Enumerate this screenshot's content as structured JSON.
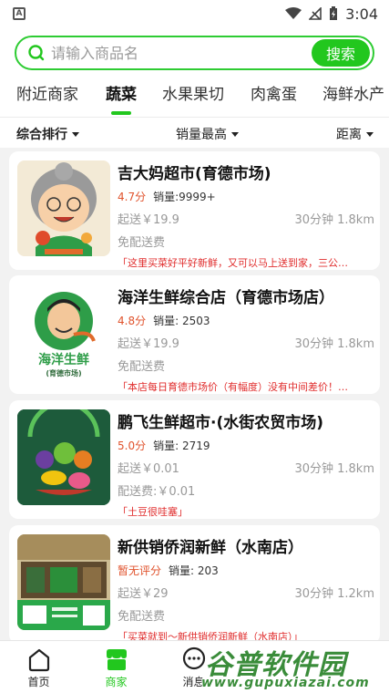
{
  "status_bar": {
    "time": "3:04",
    "left_badge": "A"
  },
  "search": {
    "placeholder": "请输入商品名",
    "button_label": "搜索"
  },
  "tabs": [
    {
      "label": "附近商家",
      "active": false
    },
    {
      "label": "蔬菜",
      "active": true
    },
    {
      "label": "水果果切",
      "active": false
    },
    {
      "label": "肉禽蛋",
      "active": false
    },
    {
      "label": "海鲜水产",
      "active": false
    }
  ],
  "filters": [
    {
      "label": "综合排行"
    },
    {
      "label": "销量最高"
    },
    {
      "label": "距离"
    }
  ],
  "stores": [
    {
      "name": "吉大妈超市(育德市场)",
      "rating": "4.7分",
      "sales": "销量:9999+",
      "min_order": "起送￥19.9",
      "delivery_time_distance": "30分钟 1.8km",
      "delivery_fee": "免配送费",
      "review": "「这里买菜好平好新鲜，又可以马上送到家，三公…"
    },
    {
      "name": "海洋生鲜综合店（育德市场店）",
      "rating": "4.8分",
      "sales": "销量: 2503",
      "min_order": "起送￥19.9",
      "delivery_time_distance": "30分钟 1.8km",
      "delivery_fee": "免配送费",
      "review": "「本店每日育德市场价（有幅度）没有中间差价！…",
      "logo_text_main": "海洋生鲜",
      "logo_text_sub": "(育德市场)"
    },
    {
      "name": "鹏飞生鲜超市·(水街农贸市场)",
      "rating": "5.0分",
      "sales": "销量: 2719",
      "min_order": "起送￥0.01",
      "delivery_time_distance": "30分钟 1.8km",
      "delivery_fee": "配送费:￥0.01",
      "review": "「土豆很哇塞」"
    },
    {
      "name": "新供销侨润新鲜（水南店）",
      "rating": "暂无评分",
      "sales": "销量: 203",
      "min_order": "起送￥29",
      "delivery_time_distance": "30分钟 1.2km",
      "delivery_fee": "免配送费",
      "review": "「买菜就到～新供销侨润新鲜（水南店）」"
    }
  ],
  "bottom_nav": [
    {
      "label": "首页",
      "icon": "home-icon",
      "active": false
    },
    {
      "label": "商家",
      "icon": "store-icon",
      "active": true
    },
    {
      "label": "消息",
      "icon": "message-icon",
      "active": false
    }
  ],
  "watermark": {
    "title": "谷普软件园",
    "url": "www.gupuxiazai.com"
  },
  "colors": {
    "accent": "#22c71e",
    "rating": "#e0522c",
    "review": "#e02c2c"
  }
}
